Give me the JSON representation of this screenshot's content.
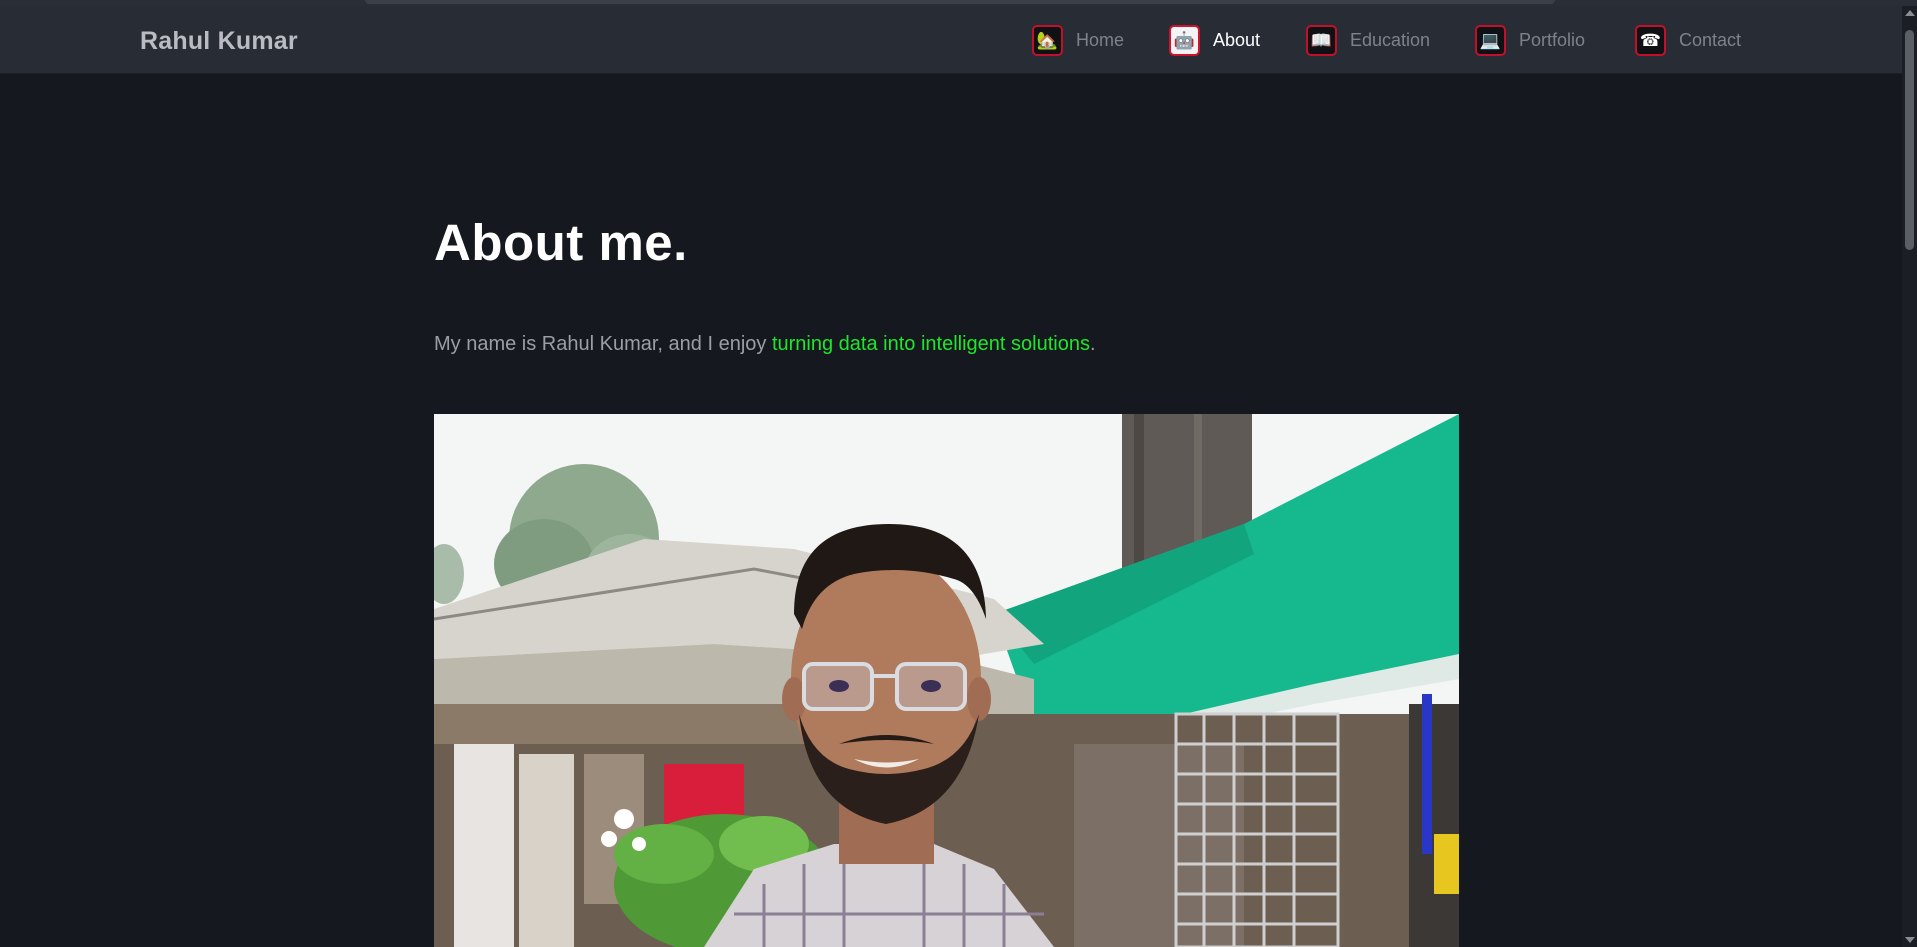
{
  "brand": "Rahul Kumar",
  "nav": {
    "items": [
      {
        "label": "Home",
        "icon": "home-icon",
        "glyph": "🏡"
      },
      {
        "label": "About",
        "icon": "robot-icon",
        "glyph": "🤖"
      },
      {
        "label": "Education",
        "icon": "book-icon",
        "glyph": "📖"
      },
      {
        "label": "Portfolio",
        "icon": "laptop-icon",
        "glyph": "💻"
      },
      {
        "label": "Contact",
        "icon": "telephone-icon",
        "glyph": "☎"
      }
    ],
    "active": "About"
  },
  "about": {
    "heading": "About me.",
    "intro_prefix": "My name is Rahul Kumar, and I enjoy ",
    "intro_highlight": "turning data into intelligent solutions",
    "intro_suffix": ".",
    "photo_alt": "Rahul Kumar"
  },
  "colors": {
    "background": "#15181f",
    "navbar": "#272c35",
    "highlight": "#1ee62a",
    "icon_border": "#c3102a"
  }
}
